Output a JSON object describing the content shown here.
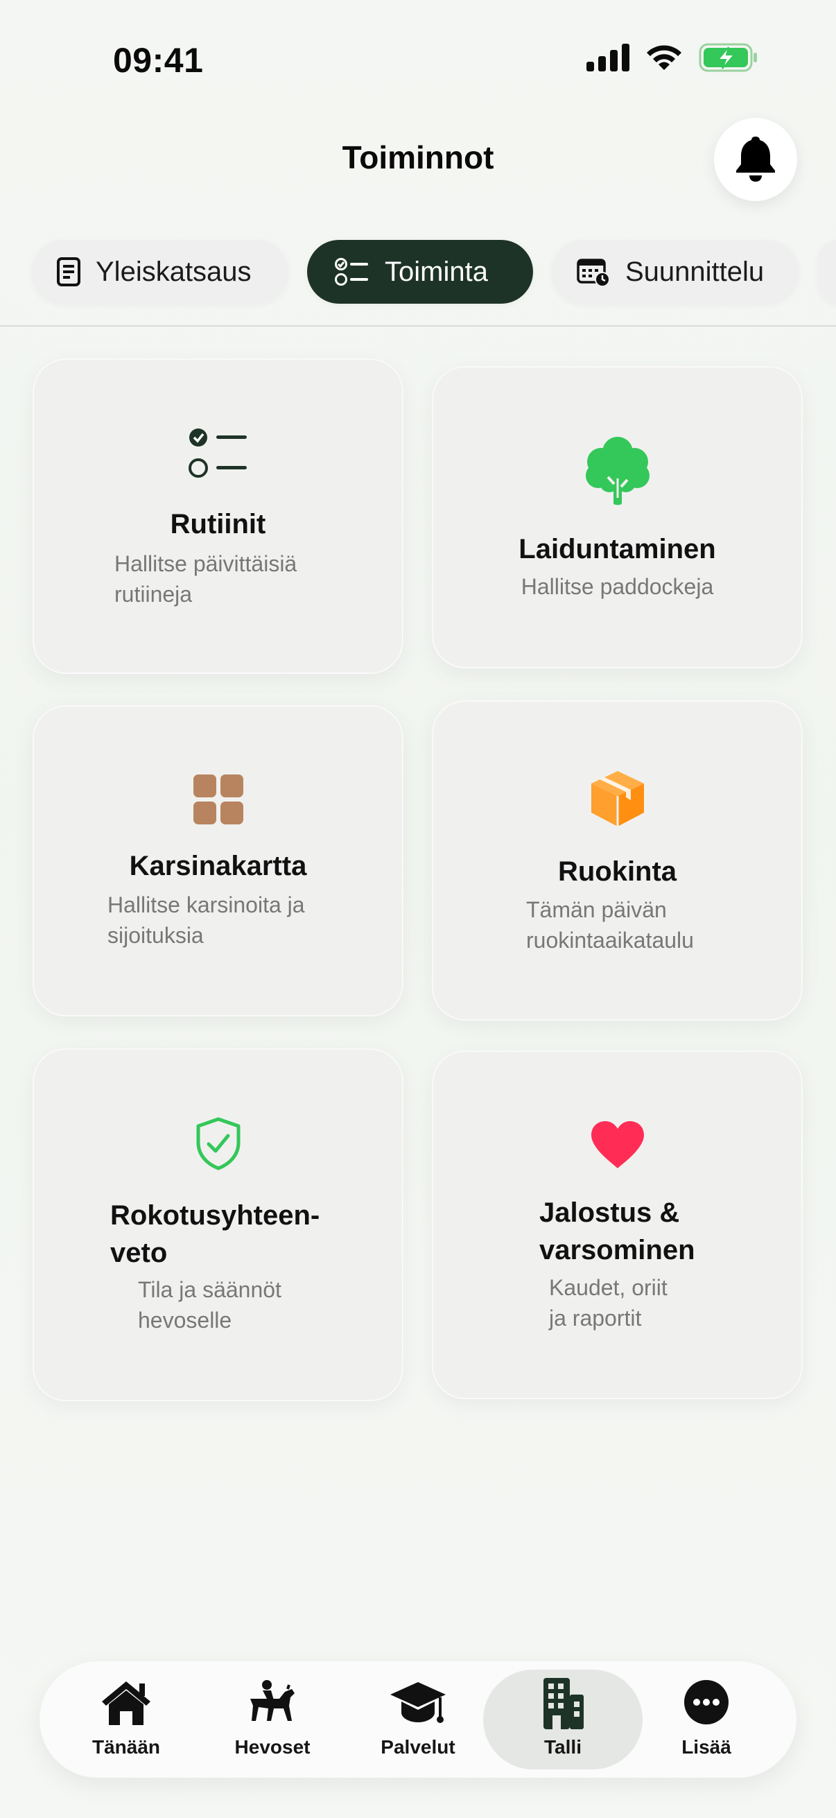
{
  "status_bar": {
    "time": "09:41"
  },
  "header": {
    "title": "Toiminnot",
    "notification_icon": "bell-icon"
  },
  "tabs": [
    {
      "label": "Yleiskatsaus",
      "icon": "document-icon",
      "active": false
    },
    {
      "label": "Toiminta",
      "icon": "checklist-icon",
      "active": true
    },
    {
      "label": "Suunnittelu",
      "icon": "calendar-clock-icon",
      "active": false
    }
  ],
  "cards": [
    {
      "title": "Rutiinit",
      "subtitle_lines": [
        "Hallitse päivittäisiä",
        "rutiineja"
      ],
      "icon": "checklist-icon",
      "icon_color": "#1e3327"
    },
    {
      "title": "Laiduntaminen",
      "subtitle_lines": [
        "Hallitse paddockeja"
      ],
      "icon": "tree-icon",
      "icon_color": "#34c759"
    },
    {
      "title": "Karsinakartta",
      "subtitle_lines": [
        "Hallitse karsinoita ja",
        "sijoituksia"
      ],
      "icon": "grid-icon",
      "icon_color": "#b8845f"
    },
    {
      "title": "Ruokinta",
      "subtitle_lines": [
        "Tämän päivän",
        "ruokintaaikataulu"
      ],
      "icon": "box-icon",
      "icon_color": "#ff9f2e"
    },
    {
      "title_lines": [
        "Rokotusyhteen-",
        "veto"
      ],
      "subtitle_lines": [
        "Tila ja säännöt",
        "hevoselle"
      ],
      "icon": "shield-check-icon",
      "icon_color": "#34c759"
    },
    {
      "title_lines": [
        "Jalostus &",
        "varsominen"
      ],
      "subtitle_lines": [
        "Kaudet, oriit",
        "ja raportit"
      ],
      "icon": "heart-icon",
      "icon_color": "#ff2d55"
    }
  ],
  "bottom_nav": [
    {
      "label": "Tänään",
      "icon": "house-icon",
      "active": false
    },
    {
      "label": "Hevoset",
      "icon": "horse-rider-icon",
      "active": false
    },
    {
      "label": "Palvelut",
      "icon": "graduation-cap-icon",
      "active": false
    },
    {
      "label": "Talli",
      "icon": "building-icon",
      "active": true
    },
    {
      "label": "Lisää",
      "icon": "more-icon",
      "active": false
    }
  ],
  "colors": {
    "accent_dark": "#1e3327",
    "green": "#34c759",
    "brown": "#b8845f",
    "orange": "#ff9f2e",
    "red": "#ff2d55"
  }
}
